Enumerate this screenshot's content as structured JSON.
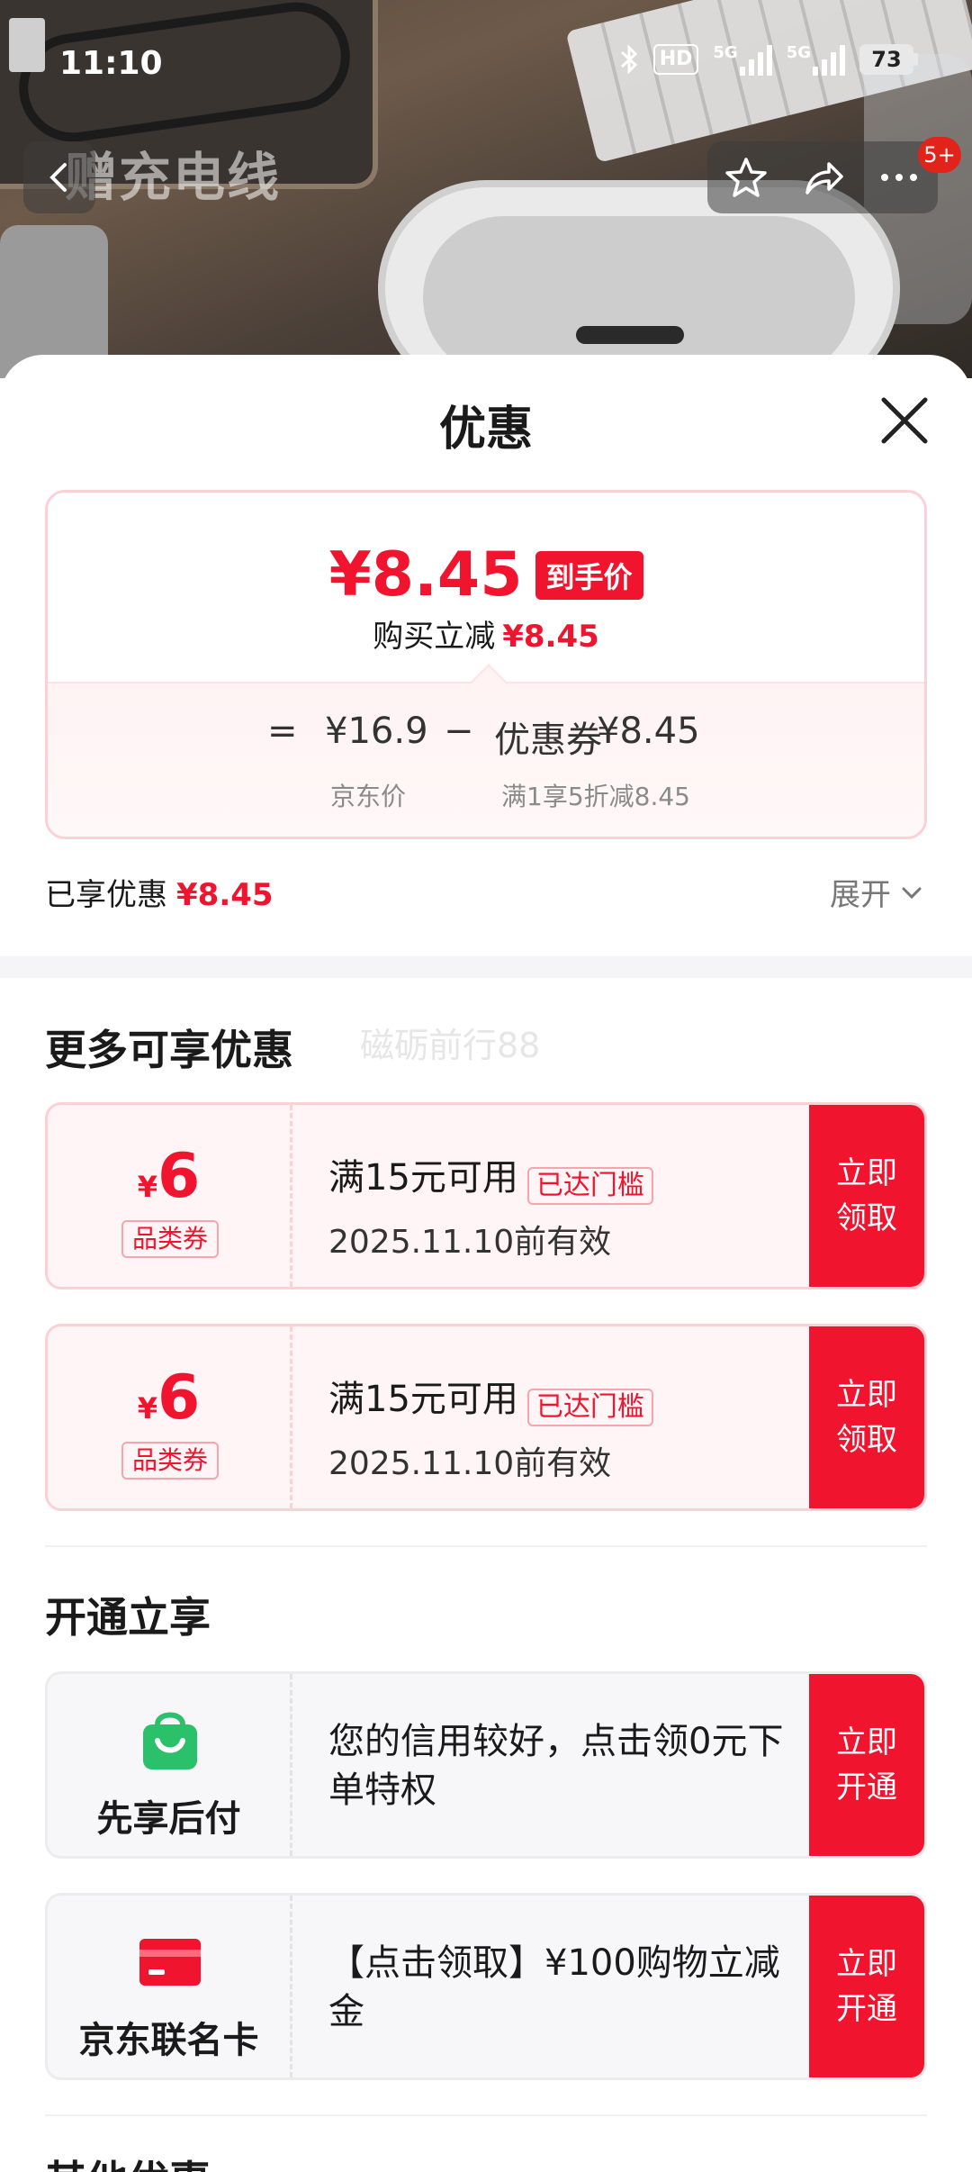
{
  "status_bar": {
    "time": "11:10",
    "hd_label": "HD",
    "network_1": "5G",
    "network_2": "5G",
    "battery": "73"
  },
  "product_photo": {
    "caption": "赠充电线",
    "more_badge": "5+"
  },
  "sheet": {
    "title": "优惠",
    "price_card": {
      "final_price": "¥8.45",
      "final_tag": "到手价",
      "reduce_label": "购买立减",
      "reduce_amount": "¥8.45",
      "equals": "=",
      "jd_price": "¥16.9",
      "minus": "−",
      "coupon_label": "优惠券",
      "coupon_amount": "¥8.45",
      "jd_price_caption": "京东价",
      "coupon_caption": "满1享5折减8.45"
    },
    "enjoyed": {
      "label": "已享优惠",
      "amount": "¥8.45",
      "expand_label": "展开"
    },
    "more_offers": {
      "title": "更多可享优惠",
      "watermark": "磁砺前行88",
      "coupons": [
        {
          "currency": "¥",
          "value": "6",
          "category": "品类券",
          "condition": "满15元可用",
          "reached_tag": "已达门槛",
          "valid_until": "2025.11.10前有效",
          "button": "立即\n领取"
        },
        {
          "currency": "¥",
          "value": "6",
          "category": "品类券",
          "condition": "满15元可用",
          "reached_tag": "已达门槛",
          "valid_until": "2025.11.10前有效",
          "button": "立即\n领取"
        }
      ]
    },
    "open_enjoy": {
      "title": "开通立享",
      "services": [
        {
          "icon": "shopping-bag-icon",
          "icon_color": "#2bc06a",
          "name": "先享后付",
          "description": "您的信用较好，点击领0元下单特权",
          "button": "立即\n开通"
        },
        {
          "icon": "credit-card-icon",
          "icon_color": "#f0142e",
          "name": "京东联名卡",
          "description": "【点击领取】¥100购物立减金",
          "button": "立即\n开通"
        }
      ]
    },
    "other_offers": {
      "title": "其他优惠"
    }
  },
  "colors": {
    "accent_red": "#f0142e",
    "coupon_border": "#fbd1d6"
  }
}
